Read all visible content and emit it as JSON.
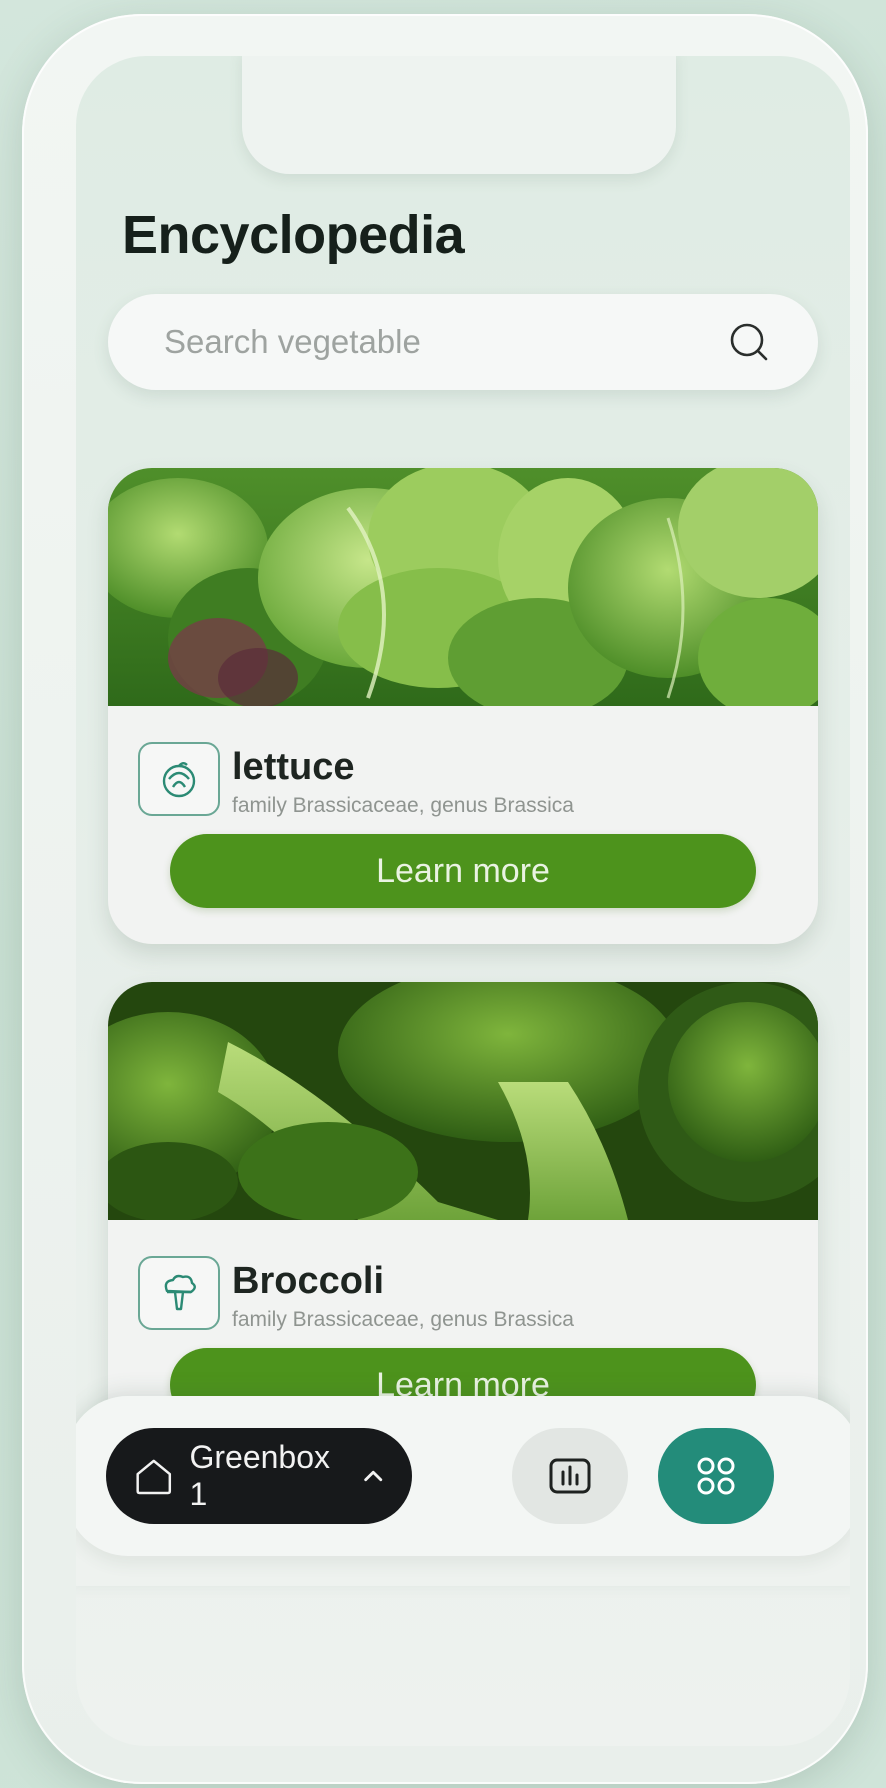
{
  "page": {
    "title": "Encyclopedia"
  },
  "search": {
    "placeholder": "Search vegetable",
    "icon": "search-icon"
  },
  "cards": [
    {
      "name": "lettuce",
      "family": "family Brassicaceae, genus Brassica",
      "button_label": "Learn more",
      "icon": "lettuce-icon"
    },
    {
      "name": "Broccoli",
      "family": "family Brassicaceae, genus Brassica",
      "button_label": "Learn more",
      "icon": "broccoli-icon"
    }
  ],
  "bottom_nav": {
    "greenbox_label": "Greenbox 1",
    "greenbox_icon": "home-icon",
    "dropdown_icon": "chevron-up-icon",
    "stats_icon": "bar-chart-icon",
    "apps_icon": "grid-icon"
  },
  "colors": {
    "accent_green": "#4d931c",
    "teal": "#238c7a",
    "dark_pill": "#17191b"
  }
}
